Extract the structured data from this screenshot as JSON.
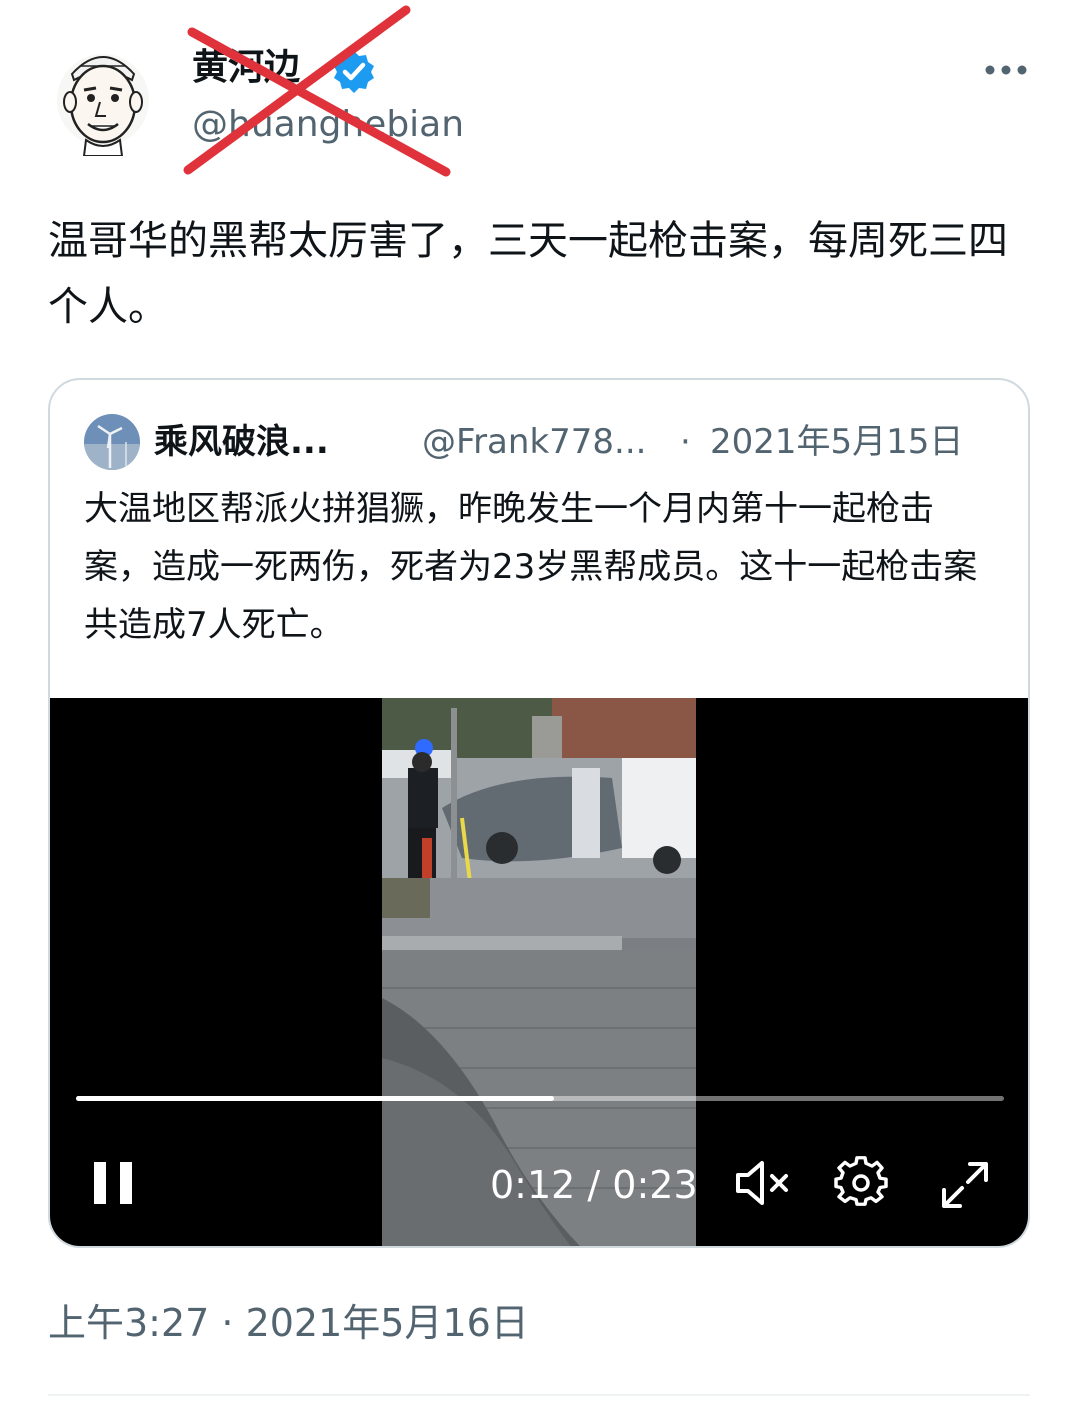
{
  "post": {
    "author": {
      "name": "黄河边",
      "handle": "@huanghebian",
      "verified": true,
      "avatar_icon": "cartoon-face-avatar"
    },
    "text": "温哥华的黑帮太厉害了，三天一起枪击案，每周死三四个人。",
    "timestamp": "上午3:27 · 2021年5月16日"
  },
  "quote": {
    "author": {
      "name": "乘风破浪...",
      "handle": "@Frank778...",
      "avatar_icon": "wind-turbine-avatar"
    },
    "separator": "·",
    "date": "2021年5月15日",
    "text": "大温地区帮派火拼猖獗，昨晚发生一个月内第十一起枪击案，造成一死两伤，死者为23岁黑帮成员。这十一起枪击案共造成7人死亡。"
  },
  "video": {
    "time_display": "0:12 / 0:23",
    "progress_fraction": 0.515,
    "state": "playing",
    "muted": true
  },
  "colors": {
    "text": "#0f1419",
    "secondary": "#536471",
    "verified": "#1d9bf0",
    "cross_mark": "#e0323a",
    "card_border": "#cfd9de"
  },
  "icons": [
    "more-icon",
    "verified-badge-icon",
    "pause-icon",
    "volume-muted-icon",
    "gear-icon",
    "fullscreen-icon"
  ]
}
